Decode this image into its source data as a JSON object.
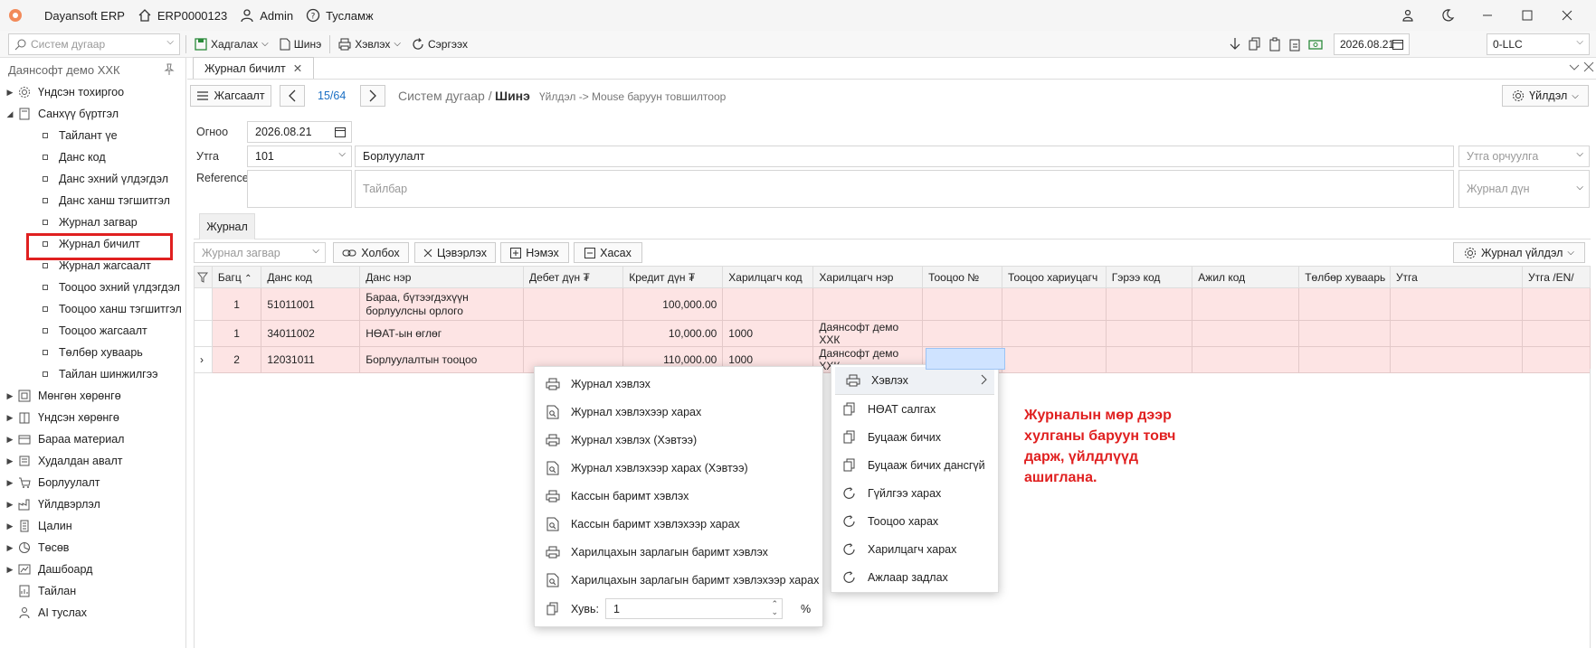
{
  "titlebar": {
    "app": "Dayansoft ERP",
    "system_no": "ERP0000123",
    "user": "Admin",
    "help": "Тусламж"
  },
  "toolbar": {
    "search_placeholder": "Систем дугаар",
    "save": "Хадгалах",
    "new": "Шинэ",
    "print": "Хэвлэх",
    "refresh": "Сэргээх",
    "date": "2026.08.21",
    "company": "0-LLC"
  },
  "sidebar": {
    "title": "Даянсофт демо ХХК",
    "items": [
      {
        "label": "Үндсэн тохиргоо",
        "level": 0,
        "icon": "gear-icon",
        "state": "collapsed"
      },
      {
        "label": "Санхүү бүртгэл",
        "level": 0,
        "icon": "ledger-icon",
        "state": "expanded"
      },
      {
        "label": "Тайлант үе",
        "level": 1
      },
      {
        "label": "Данс код",
        "level": 1
      },
      {
        "label": "Данс эхний үлдэгдэл",
        "level": 1
      },
      {
        "label": "Данс ханш тэгшитгэл",
        "level": 1
      },
      {
        "label": "Журнал загвар",
        "level": 1
      },
      {
        "label": "Журнал бичилт",
        "level": 1,
        "selected": true
      },
      {
        "label": "Журнал жагсаалт",
        "level": 1
      },
      {
        "label": "Тооцоо эхний үлдэгдэл",
        "level": 1
      },
      {
        "label": "Тооцоо ханш тэгшитгэл",
        "level": 1
      },
      {
        "label": "Тооцоо жагсаалт",
        "level": 1
      },
      {
        "label": "Төлбөр хуваарь",
        "level": 1
      },
      {
        "label": "Тайлан шинжилгээ",
        "level": 1
      },
      {
        "label": "Мөнгөн хөрөнгө",
        "level": 0,
        "icon": "cash-icon",
        "state": "collapsed"
      },
      {
        "label": "Үндсэн хөрөнгө",
        "level": 0,
        "icon": "asset-icon",
        "state": "collapsed"
      },
      {
        "label": "Бараа материал",
        "level": 0,
        "icon": "box-icon",
        "state": "collapsed"
      },
      {
        "label": "Худалдан авалт",
        "level": 0,
        "icon": "purchase-icon",
        "state": "collapsed"
      },
      {
        "label": "Борлуулалт",
        "level": 0,
        "icon": "cart-icon",
        "state": "collapsed"
      },
      {
        "label": "Үйлдвэрлэл",
        "level": 0,
        "icon": "factory-icon",
        "state": "collapsed"
      },
      {
        "label": "Цалин",
        "level": 0,
        "icon": "payroll-icon",
        "state": "collapsed"
      },
      {
        "label": "Төсөв",
        "level": 0,
        "icon": "budget-icon",
        "state": "collapsed"
      },
      {
        "label": "Дашбоард",
        "level": 0,
        "icon": "dashboard-icon",
        "state": "collapsed"
      },
      {
        "label": "Тайлан",
        "level": 0,
        "icon": "report-icon",
        "state": "none"
      },
      {
        "label": "AI туслах",
        "level": 0,
        "icon": "ai-icon",
        "state": "none"
      }
    ]
  },
  "doc_tab": {
    "label": "Журнал бичилт"
  },
  "nav": {
    "list_button": "Жагсаалт",
    "counter": "15/64",
    "breadcrumb_parent": "Систем дугаар /",
    "breadcrumb_current": "Шинэ",
    "hint": "Үйлдэл -> Mouse баруун товшилтоор",
    "actions_button": "Үйлдэл"
  },
  "form": {
    "date_label": "Огноо",
    "date_value": "2026.08.21",
    "code_label": "Утга",
    "code_value": "101",
    "desc_value": "Борлуулалт",
    "translation_placeholder": "Утга орчуулга",
    "reference_label": "Reference",
    "note_placeholder": "Тайлбар",
    "amount_placeholder": "Журнал дүн"
  },
  "journal_tab": {
    "label": "Журнал"
  },
  "grid_toolbar": {
    "template_placeholder": "Журнал загвар",
    "link": "Холбох",
    "clear": "Цэвэрлэх",
    "add": "Нэмэх",
    "remove": "Хасах",
    "journal_action": "Журнал үйлдэл"
  },
  "grid": {
    "columns": [
      "Багц",
      "Данс код",
      "Данс нэр",
      "Дебет дүн ₮",
      "Кредит дүн ₮",
      "Харилцагч код",
      "Харилцагч нэр",
      "Тооцоо №",
      "Тооцоо хариуцагч",
      "Гэрээ код",
      "Ажил код",
      "Төлбөр хуваарь",
      "Утга",
      "Утга /EN/"
    ],
    "rows": [
      {
        "batch": "1",
        "account_code": "51011001",
        "account_name": "Бараа, бүтээгдэхүүн борлуулсны орлого",
        "debit": "",
        "credit": "100,000.00",
        "partner_code": "",
        "partner_name": ""
      },
      {
        "batch": "1",
        "account_code": "34011002",
        "account_name": "НӨАТ-ын өглөг",
        "debit": "",
        "credit": "10,000.00",
        "partner_code": "1000",
        "partner_name": "Даянсофт демо ХХК"
      },
      {
        "batch": "2",
        "account_code": "12031011",
        "account_name": "Борлуулалтын тооцоо",
        "debit": "",
        "credit": "110,000.00",
        "partner_code": "1000",
        "partner_name": "Даянсофт демо ХХК"
      }
    ]
  },
  "context_menu": {
    "items": [
      "Хэвлэх",
      "НӨАТ салгах",
      "Буцааж бичих",
      "Буцааж бичих дансгүй",
      "Гүйлгээ харах",
      "Тооцоо харах",
      "Харилцагч харах",
      "Ажлаар задлах"
    ]
  },
  "print_submenu": {
    "items": [
      "Журнал хэвлэх",
      "Журнал хэвлэхээр харах",
      "Журнал хэвлэх (Хэвтээ)",
      "Журнал хэвлэхээр харах (Хэвтээ)",
      "Кассын баримт хэвлэх",
      "Кассын баримт хэвлэхээр харах",
      "Харилцахын зарлагын баримт хэвлэх",
      "Харилцахын зарлагын баримт хэвлэхээр харах"
    ],
    "copies_label": "Хувь:",
    "copies_value": "1",
    "percent": "%"
  },
  "annotation": "Журналын мөр дээр хулганы баруун товч дарж, үйлдлүүд ашиглана.",
  "colors": {
    "highlight": "#e02020",
    "row_bg": "#fde4e4",
    "link": "#1a6fc4"
  }
}
